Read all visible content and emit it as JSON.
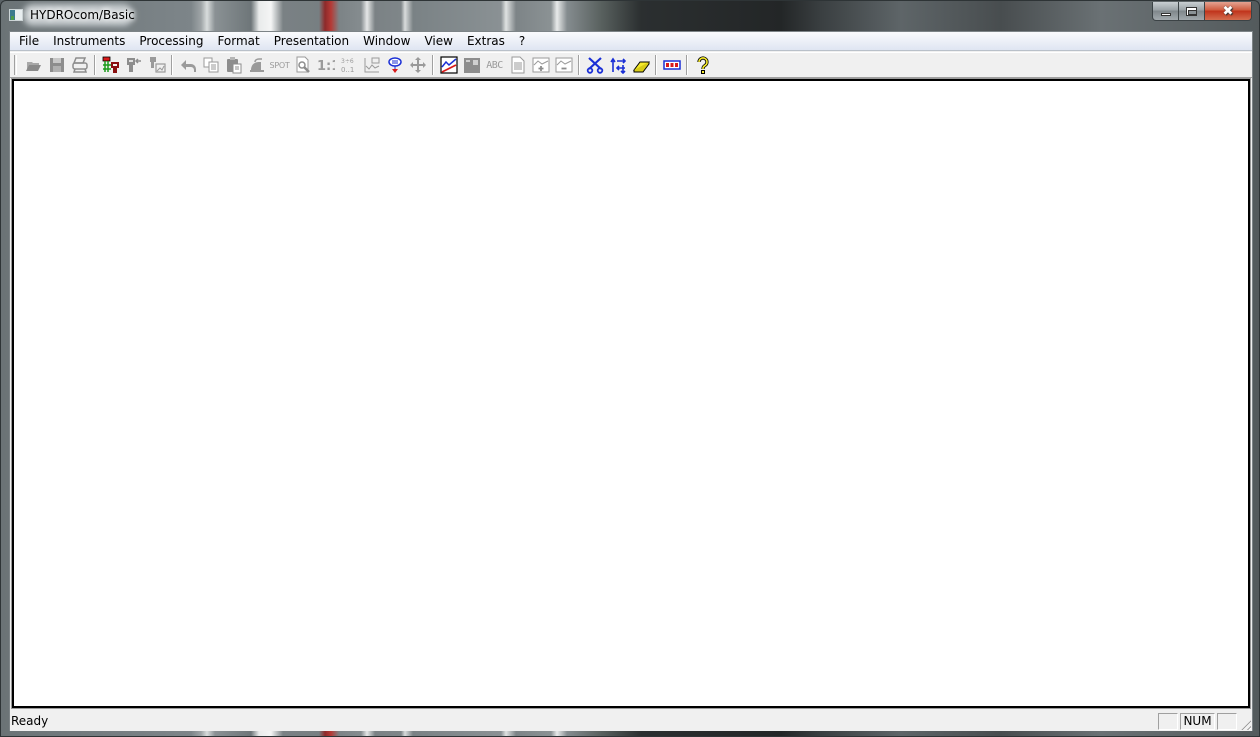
{
  "window": {
    "title": "HYDROcom/Basic",
    "caption_buttons": {
      "minimize": "minimize",
      "maximize": "maximize",
      "close": "✖"
    }
  },
  "menu": {
    "items": [
      {
        "label": "File"
      },
      {
        "label": "Instruments"
      },
      {
        "label": "Processing"
      },
      {
        "label": "Format"
      },
      {
        "label": "Presentation"
      },
      {
        "label": "Window"
      },
      {
        "label": "View"
      },
      {
        "label": "Extras"
      },
      {
        "label": "?"
      }
    ]
  },
  "toolbar": {
    "groups": [
      [
        "open-icon",
        "save-icon",
        "print-icon"
      ],
      [
        "instrument-connect-icon",
        "instrument-read-icon",
        "instrument-chart-icon"
      ],
      [
        "undo-icon",
        "copy-icon",
        "paste-icon",
        "iron-icon",
        "spot-icon",
        "zoom-page-icon",
        "one-to-one-icon",
        "scale-icon",
        "graph-label-icon",
        "filter-down-icon",
        "move-icon"
      ],
      [
        "line-chart-icon",
        "bar-chart-icon",
        "abc-icon",
        "document-icon",
        "zoom-in-chart-icon",
        "zoom-out-chart-icon"
      ],
      [
        "cut-tool-icon",
        "swap-arrows-icon",
        "eraser-icon"
      ],
      [
        "battery-icon"
      ],
      [
        "help-icon"
      ]
    ],
    "spot_label": "SPOT",
    "abc_label": "ABC",
    "one_to_one_label": "1:1",
    "colors": {
      "disabled": "#9a9a9a",
      "blue": "#1a2fd6",
      "red": "#d91a1a",
      "yellow": "#f5ea2a",
      "green": "#1a9a1a",
      "maroon": "#8a1010"
    }
  },
  "statusbar": {
    "text": "Ready",
    "panes": [
      {
        "name": "caps",
        "label": ""
      },
      {
        "name": "num",
        "label": "NUM"
      },
      {
        "name": "scroll",
        "label": ""
      }
    ]
  }
}
